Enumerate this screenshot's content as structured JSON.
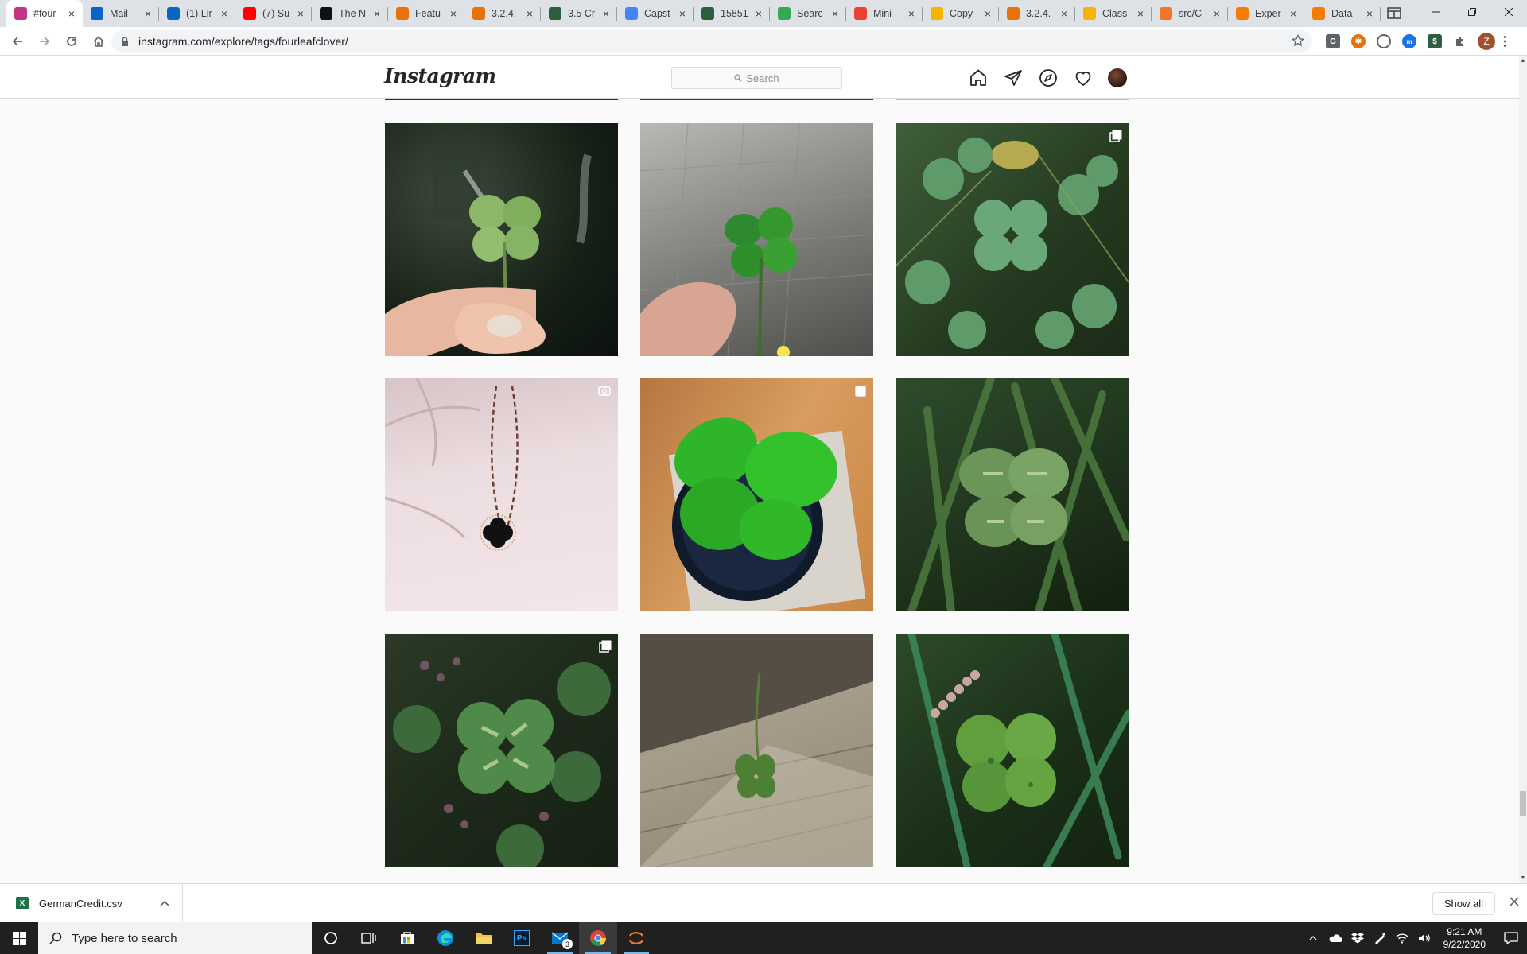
{
  "browser": {
    "tabs": [
      {
        "title": "#four",
        "icon": "instagram-icon",
        "color": "#c13584",
        "active": true
      },
      {
        "title": "Mail -",
        "icon": "outlook-icon",
        "color": "#0a64c8"
      },
      {
        "title": "(1) Lir",
        "icon": "linkedin-icon",
        "color": "#0a66c2"
      },
      {
        "title": "(7) Su",
        "icon": "youtube-icon",
        "color": "#ff0000"
      },
      {
        "title": "The N",
        "icon": "nytimes-icon",
        "color": "#111111"
      },
      {
        "title": "Featu",
        "icon": "chart-icon",
        "color": "#e8710a"
      },
      {
        "title": "3.2.4.",
        "icon": "chart-icon",
        "color": "#e8710a"
      },
      {
        "title": "3.5 Cr",
        "icon": "course-icon",
        "color": "#2d5f3f"
      },
      {
        "title": "Capst",
        "icon": "docs-icon",
        "color": "#4285f4"
      },
      {
        "title": "15851",
        "icon": "course-icon",
        "color": "#2d5f3f"
      },
      {
        "title": "Searc",
        "icon": "drive-icon",
        "color": "#34a853"
      },
      {
        "title": "Mini-",
        "icon": "infinity-icon",
        "color": "#e94235"
      },
      {
        "title": "Copy",
        "icon": "infinity-icon",
        "color": "#f4b400"
      },
      {
        "title": "3.2.4.",
        "icon": "chart-icon",
        "color": "#e8710a"
      },
      {
        "title": "Class",
        "icon": "ni-icon",
        "color": "#f4b400"
      },
      {
        "title": "src/C",
        "icon": "jupyter-icon",
        "color": "#f37626"
      },
      {
        "title": "Exper",
        "icon": "notebook-icon",
        "color": "#f57c00"
      },
      {
        "title": "Data",
        "icon": "notebook-icon",
        "color": "#f57c00"
      }
    ],
    "url": "instagram.com/explore/tags/fourleafclover/",
    "profile_initial": "Z"
  },
  "instagram": {
    "logo": "Instagram",
    "search_placeholder": "Search"
  },
  "posts": [
    {
      "desc": "clover-held-by-fingers",
      "badge": "none"
    },
    {
      "desc": "clover-on-pavement",
      "badge": "none"
    },
    {
      "desc": "clover-patch",
      "badge": "multi"
    },
    {
      "desc": "clover-necklace-in-palm",
      "badge": "video"
    },
    {
      "desc": "clover-in-cup",
      "badge": "single"
    },
    {
      "desc": "clover-in-grass",
      "badge": "none"
    },
    {
      "desc": "clover-with-flowers",
      "badge": "multi"
    },
    {
      "desc": "clover-on-wood",
      "badge": "none"
    },
    {
      "desc": "clover-with-grass-blades",
      "badge": "none"
    }
  ],
  "downloads": {
    "file": "GermanCredit.csv",
    "show_all": "Show all"
  },
  "taskbar": {
    "search_placeholder": "Type here to search",
    "mail_badge": "3",
    "time": "9:21 AM",
    "date": "9/22/2020"
  }
}
